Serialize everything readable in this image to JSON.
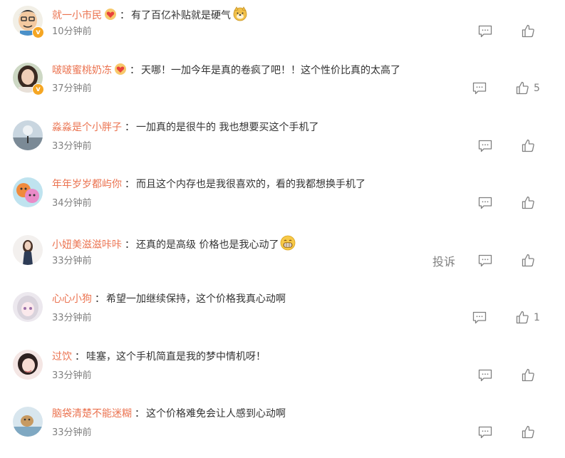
{
  "colors": {
    "username": "#eb7350",
    "text": "#333333",
    "meta": "#808080",
    "verified_badge": "#f5a623"
  },
  "report_label": "投诉",
  "comments": [
    {
      "username": "就一小市民",
      "text": "有了百亿补贴就是硬气",
      "time": "10分钟前",
      "likes": "",
      "verified": true,
      "vip_icon": "vip-heart-icon",
      "emoji": "doge-emoji-icon"
    },
    {
      "username": "啵啵蜜桃奶冻",
      "text": "天哪！一加今年是真的卷疯了吧！！这个性价比真的太高了",
      "time": "37分钟前",
      "likes": "5",
      "verified": true,
      "vip_icon": "vip-heart-icon"
    },
    {
      "username": "淼淼是个小胖子",
      "text": "一加真的是很牛的 我也想要买这个手机了",
      "time": "33分钟前",
      "likes": ""
    },
    {
      "username": "年年岁岁都屿你",
      "text": "而且这个内存也是我很喜欢的，看的我都想换手机了",
      "time": "34分钟前",
      "likes": ""
    },
    {
      "username": "小妞美滋滋咔咔",
      "text": "还真的是高级 价格也是我心动了",
      "time": "33分钟前",
      "likes": "",
      "emoji": "grin-emoji-icon",
      "show_report": true
    },
    {
      "username": "心心小狗",
      "text": "希望一加继续保持，这个价格我真心动啊",
      "time": "33分钟前",
      "likes": "1"
    },
    {
      "username": "过饮",
      "text": "哇塞，这个手机简直是我的梦中情机呀！",
      "time": "33分钟前",
      "likes": ""
    },
    {
      "username": "脑袋清楚不能迷糊",
      "text": "这个价格难免会让人感到心动啊",
      "time": "33分钟前",
      "likes": ""
    }
  ]
}
